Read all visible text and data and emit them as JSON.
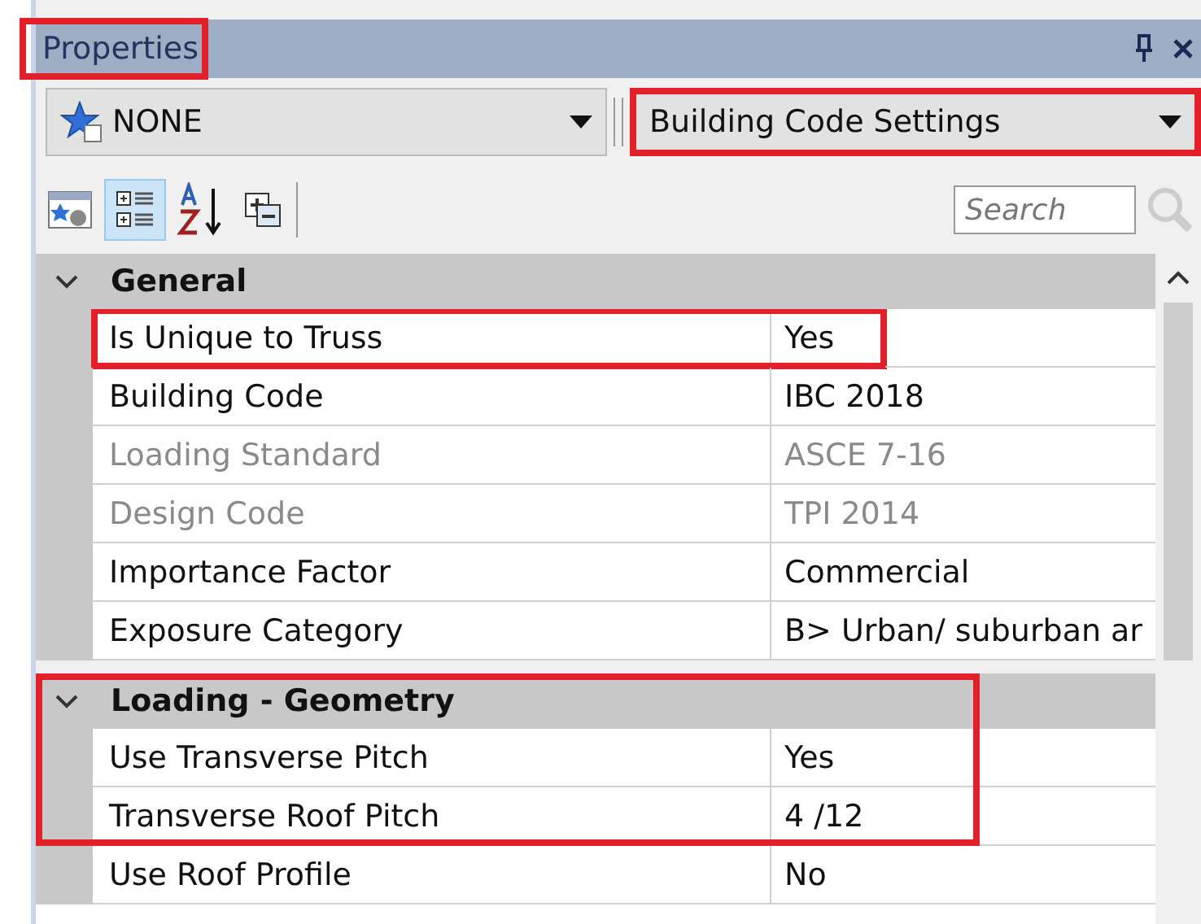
{
  "panel": {
    "title": "Properties",
    "title_highlighted": true
  },
  "selectors": [
    {
      "text": "NONE",
      "highlighted": false
    },
    {
      "text": "Building Code Settings",
      "highlighted": true
    }
  ],
  "toolbar": {
    "search": {
      "placeholder": "Search"
    }
  },
  "groups": [
    {
      "name": "General",
      "expanded": true,
      "highlighted": false,
      "rows": [
        {
          "name": "Is Unique to Truss",
          "value": "Yes",
          "disabled": false,
          "highlighted": true
        },
        {
          "name": "Building Code",
          "value": "IBC 2018",
          "disabled": false,
          "highlighted": false
        },
        {
          "name": "Loading Standard",
          "value": "ASCE 7-16",
          "disabled": true,
          "highlighted": false
        },
        {
          "name": "Design Code",
          "value": "TPI 2014",
          "disabled": true,
          "highlighted": false
        },
        {
          "name": "Importance Factor",
          "value": "Commercial",
          "disabled": false,
          "highlighted": false
        },
        {
          "name": "Exposure Category",
          "value": "B> Urban/ suburban ar",
          "disabled": false,
          "highlighted": false
        }
      ]
    },
    {
      "name": "Loading - Geometry",
      "expanded": true,
      "highlighted": true,
      "rows": [
        {
          "name": "Use Transverse Pitch",
          "value": "Yes",
          "disabled": false,
          "highlighted": true
        },
        {
          "name": "Transverse Roof Pitch",
          "value": "4 /12",
          "disabled": false,
          "highlighted": true
        },
        {
          "name": "Use Roof Profile",
          "value": "No",
          "disabled": false,
          "highlighted": false
        }
      ]
    }
  ]
}
